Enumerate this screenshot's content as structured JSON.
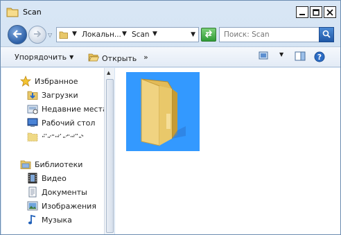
{
  "window": {
    "title": "Scan",
    "minimize_icon": "minimize-icon",
    "maximize_icon": "maximize-icon",
    "close_icon": "close-icon"
  },
  "address_bar": {
    "segments": [
      "Локальн...",
      "Scan"
    ],
    "search_placeholder": "Поиск: Scan"
  },
  "toolbar": {
    "organize_label": "Упорядочить",
    "open_label": "Открыть",
    "more_label": "»"
  },
  "nav": {
    "favorites": {
      "label": "Избранное",
      "items": [
        {
          "label": "Загрузки",
          "icon": "downloads-icon"
        },
        {
          "label": "Недавние места",
          "icon": "recent-places-icon"
        },
        {
          "label": "Рабочий стол",
          "icon": "desktop-icon"
        }
      ]
    },
    "libraries": {
      "label": "Библиотеки",
      "items": [
        {
          "label": "Видео",
          "icon": "video-icon"
        },
        {
          "label": "Документы",
          "icon": "documents-icon"
        },
        {
          "label": "Изображения",
          "icon": "pictures-icon"
        },
        {
          "label": "Музыка",
          "icon": "music-icon"
        }
      ]
    }
  },
  "colors": {
    "selection": "#3399ff",
    "frame": "#d8e6f5"
  }
}
